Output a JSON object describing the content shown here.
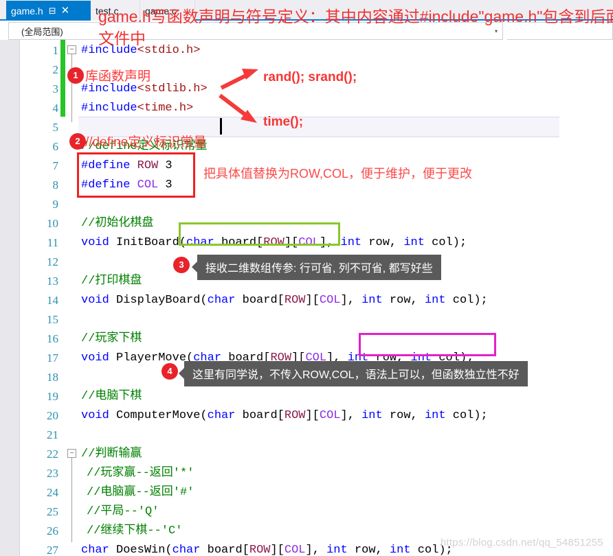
{
  "tabs": [
    {
      "label": "game.h",
      "active": true,
      "pin_icon": "pin-icon",
      "close_icon": "✕"
    },
    {
      "label": "test.c",
      "active": false
    },
    {
      "label": "game.c",
      "active": false
    }
  ],
  "navbar": {
    "scope_value": "(全局范围)",
    "chevron": "▾"
  },
  "editor": {
    "lines": [
      {
        "n": "1",
        "tokens": [
          {
            "t": "#include",
            "c": "pp"
          },
          {
            "t": "<stdio.h>",
            "c": "str"
          }
        ]
      },
      {
        "n": "2",
        "tokens": []
      },
      {
        "n": "3",
        "tokens": [
          {
            "t": "#include",
            "c": "pp"
          },
          {
            "t": "<stdlib.h>",
            "c": "str"
          }
        ]
      },
      {
        "n": "4",
        "tokens": [
          {
            "t": "#include",
            "c": "pp"
          },
          {
            "t": "<time.h>",
            "c": "str"
          }
        ]
      },
      {
        "n": "5",
        "tokens": []
      },
      {
        "n": "6",
        "tokens": [
          {
            "t": "//define定义标识常量",
            "c": "cmt"
          }
        ]
      },
      {
        "n": "7",
        "tokens": [
          {
            "t": "#define",
            "c": "pp"
          },
          {
            "t": " ",
            "c": "plain"
          },
          {
            "t": "ROW",
            "c": "macroR"
          },
          {
            "t": " 3",
            "c": "plain"
          }
        ]
      },
      {
        "n": "8",
        "tokens": [
          {
            "t": "#define",
            "c": "pp"
          },
          {
            "t": " ",
            "c": "plain"
          },
          {
            "t": "COL",
            "c": "macroC"
          },
          {
            "t": " 3",
            "c": "plain"
          }
        ]
      },
      {
        "n": "9",
        "tokens": []
      },
      {
        "n": "10",
        "tokens": [
          {
            "t": "//初始化棋盘",
            "c": "cmt"
          }
        ]
      },
      {
        "n": "11",
        "tokens": [
          {
            "t": "void",
            "c": "kw"
          },
          {
            "t": " InitBoard(",
            "c": "plain"
          },
          {
            "t": "char",
            "c": "kw"
          },
          {
            "t": " board[",
            "c": "plain"
          },
          {
            "t": "ROW",
            "c": "macroR"
          },
          {
            "t": "][",
            "c": "plain"
          },
          {
            "t": "COL",
            "c": "macroC"
          },
          {
            "t": "], ",
            "c": "plain"
          },
          {
            "t": "int",
            "c": "kw"
          },
          {
            "t": " row, ",
            "c": "plain"
          },
          {
            "t": "int",
            "c": "kw"
          },
          {
            "t": " col);",
            "c": "plain"
          }
        ]
      },
      {
        "n": "12",
        "tokens": []
      },
      {
        "n": "13",
        "tokens": [
          {
            "t": "//打印棋盘",
            "c": "cmt"
          }
        ]
      },
      {
        "n": "14",
        "tokens": [
          {
            "t": "void",
            "c": "kw"
          },
          {
            "t": " DisplayBoard(",
            "c": "plain"
          },
          {
            "t": "char",
            "c": "kw"
          },
          {
            "t": " board[",
            "c": "plain"
          },
          {
            "t": "ROW",
            "c": "macroR"
          },
          {
            "t": "][",
            "c": "plain"
          },
          {
            "t": "COL",
            "c": "macroC"
          },
          {
            "t": "], ",
            "c": "plain"
          },
          {
            "t": "int",
            "c": "kw"
          },
          {
            "t": " row, ",
            "c": "plain"
          },
          {
            "t": "int",
            "c": "kw"
          },
          {
            "t": " col);",
            "c": "plain"
          }
        ]
      },
      {
        "n": "15",
        "tokens": []
      },
      {
        "n": "16",
        "tokens": [
          {
            "t": "//玩家下棋",
            "c": "cmt"
          }
        ]
      },
      {
        "n": "17",
        "tokens": [
          {
            "t": "void",
            "c": "kw"
          },
          {
            "t": " PlayerMove(",
            "c": "plain"
          },
          {
            "t": "char",
            "c": "kw"
          },
          {
            "t": " board[",
            "c": "plain"
          },
          {
            "t": "ROW",
            "c": "macroR"
          },
          {
            "t": "][",
            "c": "plain"
          },
          {
            "t": "COL",
            "c": "macroC"
          },
          {
            "t": "], ",
            "c": "plain"
          },
          {
            "t": "int",
            "c": "kw"
          },
          {
            "t": " row, ",
            "c": "plain"
          },
          {
            "t": "int",
            "c": "kw"
          },
          {
            "t": " col);",
            "c": "plain"
          }
        ]
      },
      {
        "n": "18",
        "tokens": []
      },
      {
        "n": "19",
        "tokens": [
          {
            "t": "//电脑下棋",
            "c": "cmt"
          }
        ]
      },
      {
        "n": "20",
        "tokens": [
          {
            "t": "void",
            "c": "kw"
          },
          {
            "t": " ComputerMove(",
            "c": "plain"
          },
          {
            "t": "char",
            "c": "kw"
          },
          {
            "t": " board[",
            "c": "plain"
          },
          {
            "t": "ROW",
            "c": "macroR"
          },
          {
            "t": "][",
            "c": "plain"
          },
          {
            "t": "COL",
            "c": "macroC"
          },
          {
            "t": "], ",
            "c": "plain"
          },
          {
            "t": "int",
            "c": "kw"
          },
          {
            "t": " row, ",
            "c": "plain"
          },
          {
            "t": "int",
            "c": "kw"
          },
          {
            "t": " col);",
            "c": "plain"
          }
        ]
      },
      {
        "n": "21",
        "tokens": []
      },
      {
        "n": "22",
        "tokens": [
          {
            "t": "//判断输赢",
            "c": "cmt"
          }
        ]
      },
      {
        "n": "23",
        "tokens": [
          {
            "t": "//玩家赢--返回'*'",
            "c": "cmt"
          }
        ]
      },
      {
        "n": "24",
        "tokens": [
          {
            "t": "//电脑赢--返回'#'",
            "c": "cmt"
          }
        ]
      },
      {
        "n": "25",
        "tokens": [
          {
            "t": "//平局--'Q'",
            "c": "cmt"
          }
        ]
      },
      {
        "n": "26",
        "tokens": [
          {
            "t": "//继续下棋--'C'",
            "c": "cmt"
          }
        ]
      },
      {
        "n": "27",
        "tokens": [
          {
            "t": "char",
            "c": "kw"
          },
          {
            "t": " DoesWin(",
            "c": "plain"
          },
          {
            "t": "char",
            "c": "kw"
          },
          {
            "t": " board[",
            "c": "plain"
          },
          {
            "t": "ROW",
            "c": "macroR"
          },
          {
            "t": "][",
            "c": "plain"
          },
          {
            "t": "COL",
            "c": "macroC"
          },
          {
            "t": "], ",
            "c": "plain"
          },
          {
            "t": "int",
            "c": "kw"
          },
          {
            "t": " row, ",
            "c": "plain"
          },
          {
            "t": "int",
            "c": "kw"
          },
          {
            "t": " col);",
            "c": "plain"
          }
        ]
      }
    ]
  },
  "annotations": {
    "title_line1": "game.h写函数声明与符号定义：其中内容通过#include\"game.h\"包含到后面两个.c",
    "title_line2": "文件中",
    "lib_func": "库函数声明",
    "rand_label": "rand(); srand();",
    "time_label": "time();",
    "define_label": "//define定义标识常量",
    "replace_note": "把具体值替换为ROW,COL，便于维护，便于更改",
    "badges": [
      "1",
      "2",
      "3",
      "4"
    ],
    "tooltip3": "接收二维数组传参: 行可省, 列不可省, 都写好些",
    "tooltip4": "这里有同学说，不传入ROW,COL，语法上可以，但函数独立性不好"
  },
  "watermark": "https://blog.csdn.net/qq_54851255",
  "colors": {
    "tab_active_bg": "#007acc",
    "annotation_red": "#f03232",
    "badge_red": "#e8232a",
    "tooltip_bg": "#5a5a5a",
    "box_red": "#f02020",
    "box_green": "#8ac62b",
    "box_magenta": "#e420c8",
    "changebar_green": "#28c428",
    "keyword_blue": "#0000ff",
    "comment_green": "#008000",
    "string_red": "#a31515",
    "macro_row": "#8b1a4a",
    "macro_col": "#8a2be2",
    "linenum_blue": "#2b91af"
  }
}
